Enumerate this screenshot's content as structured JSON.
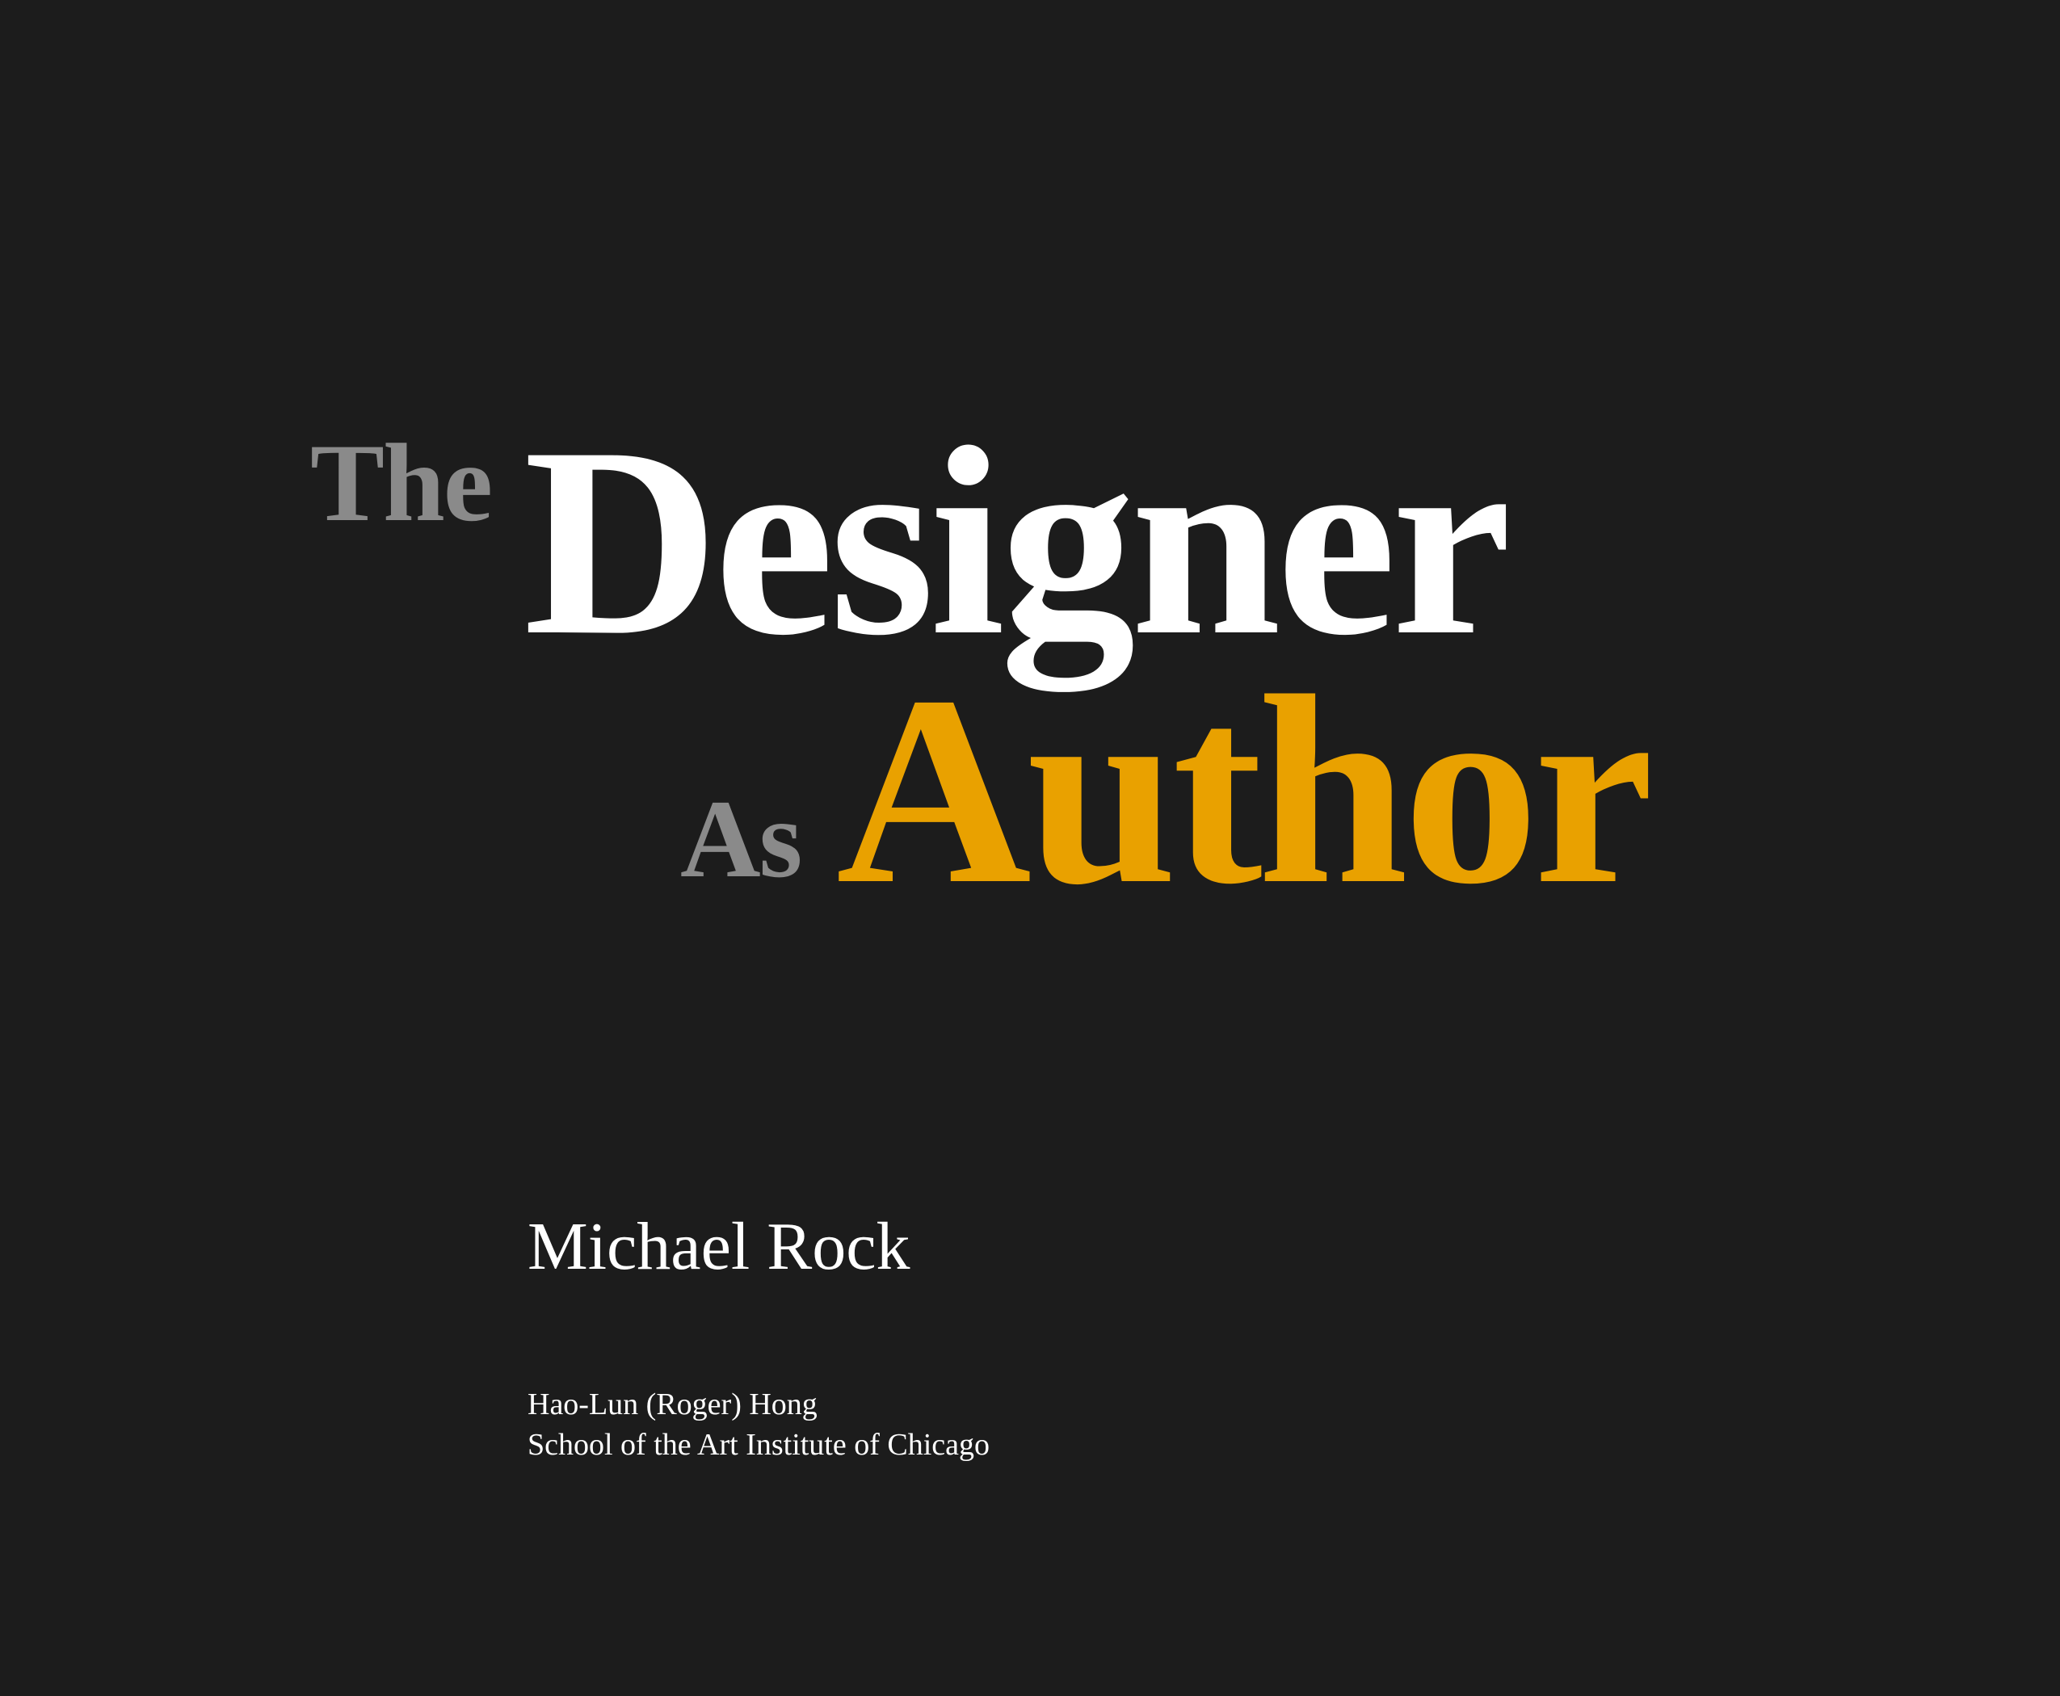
{
  "title": {
    "the": "The",
    "designer": "Designer",
    "as": "As",
    "author": "Author"
  },
  "author_name": "Michael Rock",
  "credit": {
    "name": "Hao-Lun (Roger) Hong",
    "school": "School of the Art Institute of Chicago"
  },
  "colors": {
    "background": "#1c1c1c",
    "muted_grey": "#8a8a8a",
    "white": "#ffffff",
    "accent_gold": "#e9a100"
  }
}
